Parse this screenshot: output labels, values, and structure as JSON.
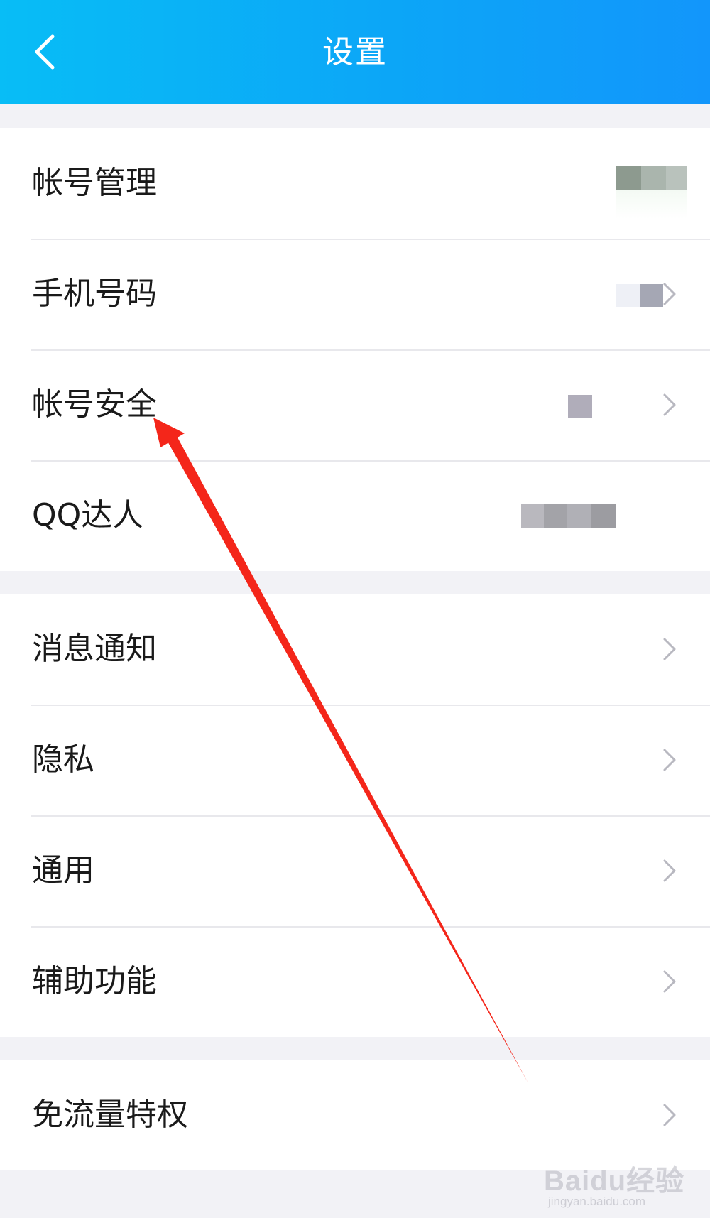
{
  "header": {
    "title": "设置",
    "back_icon": "chevron-left-icon",
    "background_gradient": [
      "#08bdf6",
      "#1296fb"
    ]
  },
  "groups": [
    {
      "items": [
        {
          "label": "帐号管理",
          "chevron": false
        },
        {
          "label": "手机号码",
          "chevron": true
        },
        {
          "label": "帐号安全",
          "chevron": true
        },
        {
          "label": "QQ达人",
          "chevron": false
        }
      ]
    },
    {
      "items": [
        {
          "label": "消息通知",
          "chevron": true
        },
        {
          "label": "隐私",
          "chevron": true
        },
        {
          "label": "通用",
          "chevron": true
        },
        {
          "label": "辅助功能",
          "chevron": true
        }
      ]
    },
    {
      "items": [
        {
          "label": "免流量特权",
          "chevron": true
        }
      ]
    }
  ],
  "annotation": {
    "type": "red-arrow",
    "color": "#f4261a",
    "points_to": "帐号安全"
  },
  "watermark": {
    "brand": "Baidu经验",
    "url": "jingyan.baidu.com"
  }
}
